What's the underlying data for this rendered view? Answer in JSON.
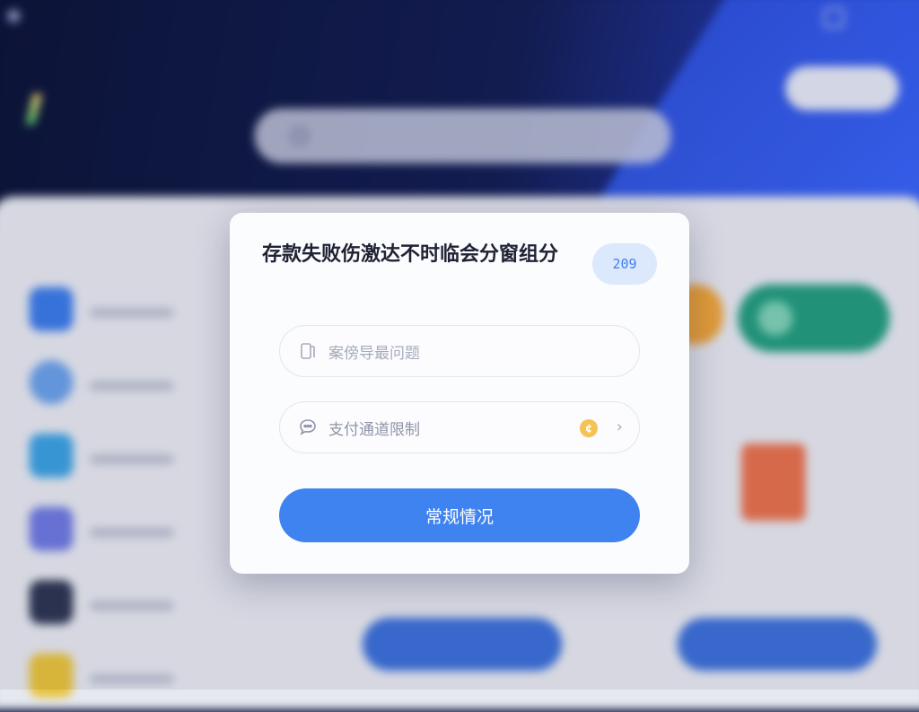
{
  "background": {
    "status": {
      "left_text": "",
      "right_text": ""
    },
    "app_title": "",
    "tagline": "",
    "search": {
      "placeholder": ""
    },
    "top_pill": "",
    "section_title": "",
    "list": [
      {
        "title": "",
        "color": "#3a7ae8"
      },
      {
        "title": "",
        "color": "#6aa0e8"
      },
      {
        "title": "",
        "color": "#3aa0e0"
      },
      {
        "title": "",
        "color": "#6d79e0"
      },
      {
        "title": "",
        "color": "#2d3552"
      },
      {
        "title": "",
        "color": "#e8c23a"
      }
    ],
    "right_label": "",
    "gift_label": "",
    "buttons": [
      "",
      ""
    ],
    "mid_text": ""
  },
  "modal": {
    "title": "存款失败伤激达不时临会分窗组分",
    "badge": "209",
    "field1": {
      "label": "案傍导最问题",
      "icon": "document-icon"
    },
    "field2": {
      "label": "支付通道限制",
      "icon": "chat-bubble-icon",
      "coin": "¢",
      "chevron": "›"
    },
    "primary_button": "常规情况"
  },
  "colors": {
    "accent": "#3f83f0",
    "badge_bg": "#dce8fb",
    "coin": "#f4c255",
    "header_dark": "#0b1336",
    "header_blue": "#2b4be0"
  }
}
